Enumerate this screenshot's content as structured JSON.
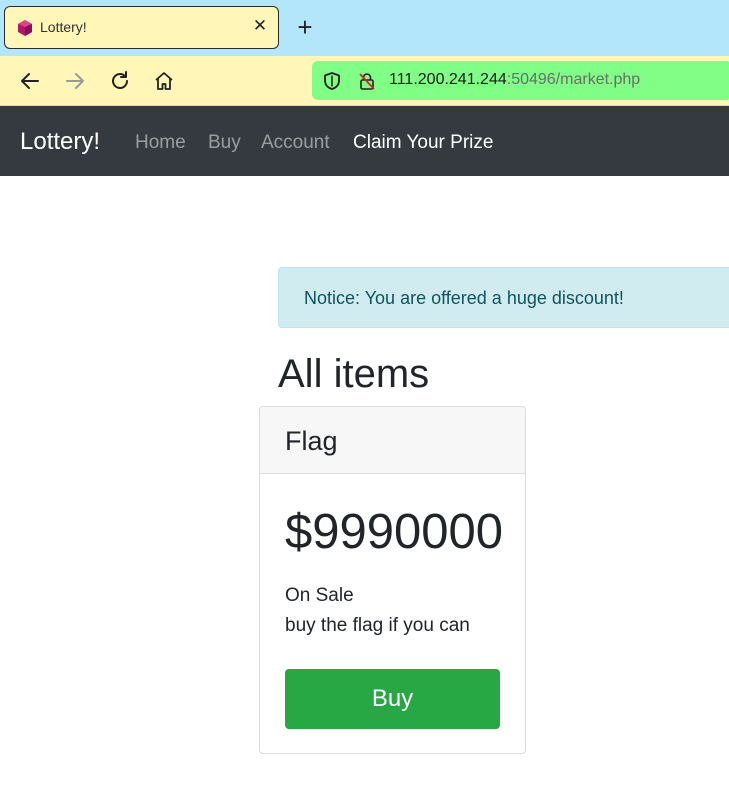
{
  "browser": {
    "tab": {
      "title": "Lottery!",
      "favicon": "polyhedron-favicon-icon",
      "close_icon": "close-icon"
    },
    "new_tab_icon": "plus-icon",
    "toolbar": {
      "back_icon": "arrow-left-icon",
      "forward_icon": "arrow-right-icon",
      "reload_icon": "reload-icon",
      "home_icon": "home-icon"
    },
    "url": {
      "host": "111.200.241.244",
      "rest": ":50496/market.php",
      "shield_icon": "shield-icon",
      "insecure_lock_icon": "insecure-lock-icon"
    },
    "colors": {
      "tabstrip": "#b3e6fb",
      "toolbar": "#fff6b8",
      "urlbar": "#80fe86"
    }
  },
  "navbar": {
    "brand": "Lottery!",
    "links": [
      {
        "label": "Home",
        "active": false
      },
      {
        "label": "Buy",
        "active": false
      },
      {
        "label": "Account",
        "active": false
      },
      {
        "label": "Claim Your Prize",
        "active": true
      }
    ],
    "bg_color": "#343a40"
  },
  "notice": {
    "text": "Notice: You are offered a huge discount!"
  },
  "main": {
    "heading": "All items",
    "card": {
      "title": "Flag",
      "price": "$9990000",
      "line1": "On Sale",
      "line2": "buy the flag if you can",
      "buy_label": "Buy",
      "button_color": "#28a745"
    }
  }
}
